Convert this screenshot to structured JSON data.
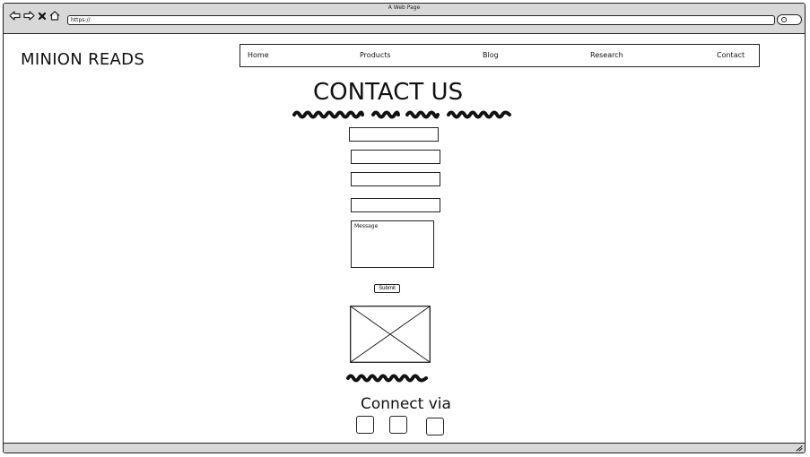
{
  "window": {
    "title": "A Web Page",
    "url": "https://"
  },
  "site": {
    "brand": "MINION READS"
  },
  "nav": {
    "items": [
      {
        "id": "home",
        "label": "Home"
      },
      {
        "id": "products",
        "label": "Products"
      },
      {
        "id": "blog",
        "label": "Blog"
      },
      {
        "id": "research",
        "label": "Research"
      },
      {
        "id": "contact",
        "label": "Contact"
      }
    ]
  },
  "contact": {
    "heading": "CONTACT US",
    "message_placeholder": "Message",
    "submit_label": "Submit"
  },
  "connect": {
    "heading": "Connect via",
    "icons": [
      "social-icon",
      "social-icon",
      "social-icon"
    ]
  },
  "icons": {
    "back": "back-arrow-icon",
    "forward": "forward-arrow-icon",
    "close": "close-icon",
    "home": "home-icon",
    "search": "search-icon",
    "resize": "resize-grip-icon"
  }
}
